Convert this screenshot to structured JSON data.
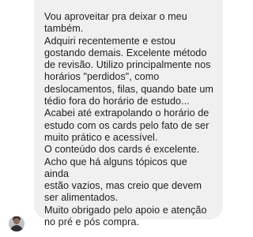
{
  "conversation": {
    "message": {
      "text": "Vou aproveitar pra deixar o meu\ntambém.\nAdquiri recentemente e estou\ngostando demais. Excelente método\nde revisão. Utilizo principalmente nos\nhorários \"perdidos\", como\ndeslocamentos, filas, quando bate um\ntédio fora do horário de estudo...\nAcabei até extrapolando o horário de\nestudo com os cards pelo fato de ser\nmuito prático e acessível.\nO conteúdo dos cards é excelente.\nAcho que há alguns tópicos que ainda\nestão vazios, mas creio que devem\nser alimentados.\nMuito obrigado pelo apoio e atenção\nno pré e pós compra."
    },
    "sender": {
      "avatar_icon": "user-avatar"
    }
  },
  "colors": {
    "bubble_background": "#f0f0f0",
    "text": "#1c1e21",
    "page_background": "#ffffff"
  }
}
